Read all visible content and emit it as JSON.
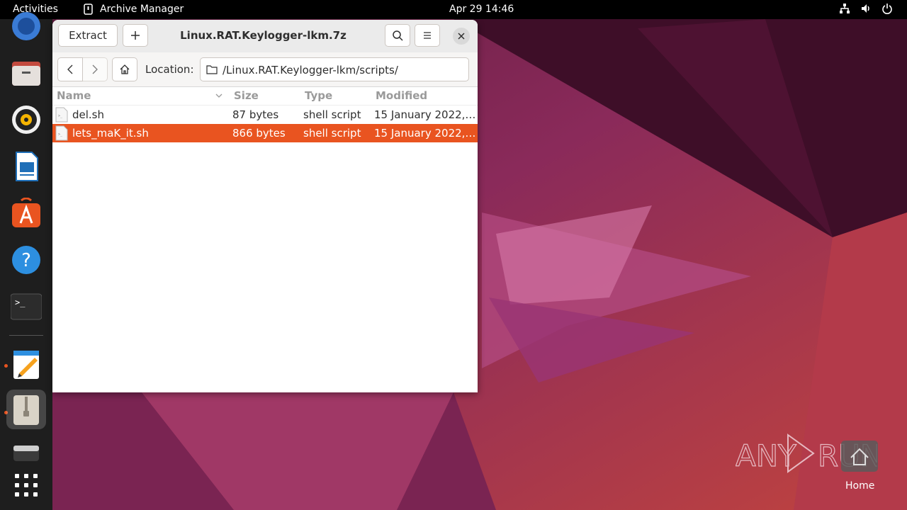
{
  "topbar": {
    "activities": "Activities",
    "app_name": "Archive Manager",
    "clock": "Apr 29  14:46"
  },
  "window": {
    "title": "Linux.RAT.Keylogger-lkm.7z",
    "extract_label": "Extract",
    "location_label": "Location:",
    "location_path": "/Linux.RAT.Keylogger-lkm/scripts/"
  },
  "list": {
    "columns": {
      "name": "Name",
      "size": "Size",
      "type": "Type",
      "modified": "Modified"
    },
    "rows": [
      {
        "name": "del.sh",
        "size": "87 bytes",
        "type": "shell script",
        "modified": "15 January 2022,…",
        "selected": false
      },
      {
        "name": "lets_maK_it.sh",
        "size": "866 bytes",
        "type": "shell script",
        "modified": "15 January 2022,…",
        "selected": true
      }
    ]
  },
  "desktop": {
    "home_label": "Home",
    "watermark": "ANY RUN"
  },
  "dock": {
    "items": [
      "firefox-icon",
      "files-icon",
      "rhythmbox-icon",
      "writer-icon",
      "app-center-icon",
      "help-icon",
      "terminal-icon",
      "text-editor-icon",
      "archive-manager-icon",
      "disks-icon",
      "show-apps-icon"
    ]
  },
  "colors": {
    "accent": "#e95420",
    "topbar": "#000000",
    "dock": "#1e1e1e"
  }
}
